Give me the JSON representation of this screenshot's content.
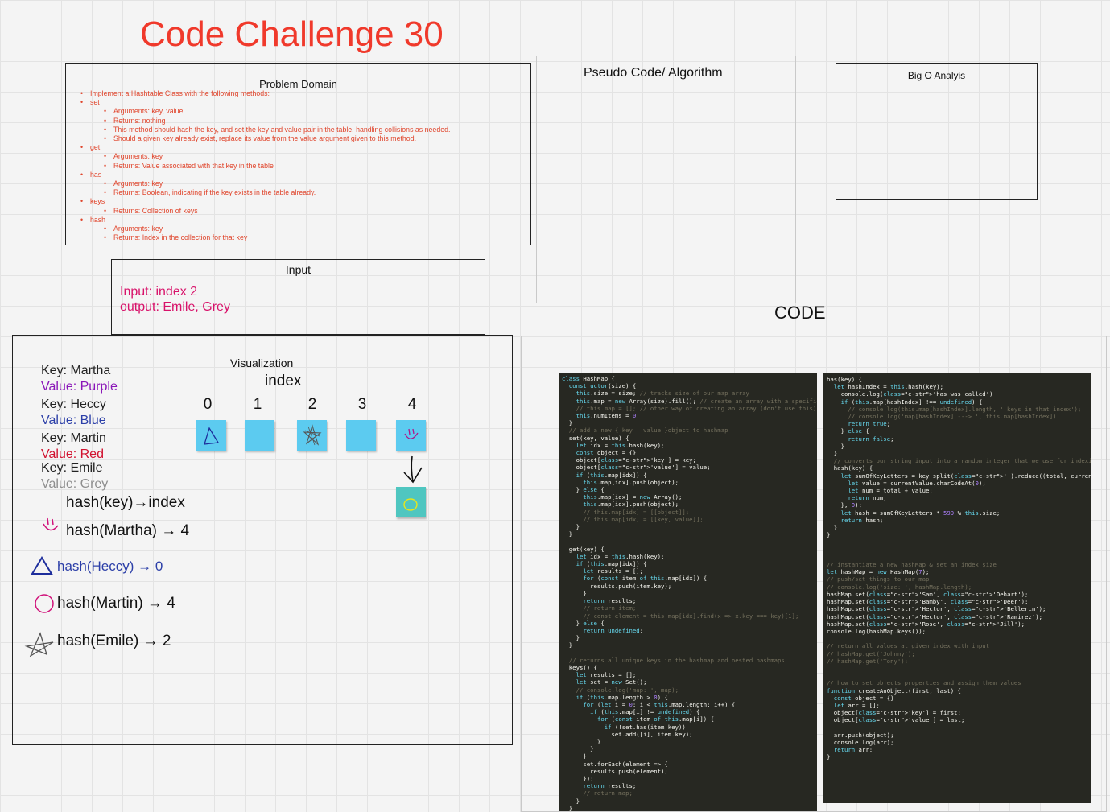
{
  "title": "Code Challenge 30",
  "problem_domain": {
    "title": "Problem Domain",
    "items": [
      {
        "level": 1,
        "text": "Implement a Hashtable Class with the following methods:"
      },
      {
        "level": 1,
        "text": "set"
      },
      {
        "level": 2,
        "text": "Arguments: key, value"
      },
      {
        "level": 2,
        "text": "Returns: nothing"
      },
      {
        "level": 2,
        "text": "This method should hash the key, and set the key and value pair in the table, handling collisions as needed."
      },
      {
        "level": 2,
        "text": "Should a given key already exist, replace its value from the value argument given to this method."
      },
      {
        "level": 1,
        "text": "get"
      },
      {
        "level": 2,
        "text": "Arguments: key"
      },
      {
        "level": 2,
        "text": "Returns: Value associated with that key in the table"
      },
      {
        "level": 1,
        "text": "has"
      },
      {
        "level": 2,
        "text": "Arguments: key"
      },
      {
        "level": 2,
        "text": "Returns: Boolean, indicating if the key exists in the table already."
      },
      {
        "level": 1,
        "text": "keys"
      },
      {
        "level": 2,
        "text": "Returns: Collection of keys"
      },
      {
        "level": 1,
        "text": "hash"
      },
      {
        "level": 2,
        "text": "Arguments: key"
      },
      {
        "level": 2,
        "text": "Returns: Index in the collection for that key"
      }
    ]
  },
  "pseudo_code": {
    "title": "Pseudo Code/ Algorithm"
  },
  "big_o": {
    "title": "Big O Analyis"
  },
  "input": {
    "title": "Input",
    "line1": "Input: index 2",
    "line2": "output: Emile, Grey"
  },
  "code_label": "CODE",
  "visualization": {
    "title": "Visualization",
    "index_label": "index",
    "indices": [
      "0",
      "1",
      "2",
      "3",
      "4"
    ],
    "pairs": [
      {
        "key": "Key: Martha",
        "value": "Value: Purple",
        "color": "#8a16b8"
      },
      {
        "key": "Key: Heccy",
        "value": "Value: Blue",
        "color": "#2c3fa8"
      },
      {
        "key": "Key: Martin",
        "value": "Value: Red",
        "color": "#d1122f"
      },
      {
        "key": "Key: Emile",
        "value": "Value: Grey",
        "color": "#8e8e8e"
      }
    ],
    "hash_formula": "hash(key)→index",
    "hash_rows": [
      {
        "text": "hash(Martha) → 4",
        "color": "#111111"
      },
      {
        "text": "hash(Heccy) → 0",
        "color": "#2c3fa8"
      },
      {
        "text": "hash(Martin) → 4",
        "color": "#111111"
      },
      {
        "text": "hash(Emile) → 2",
        "color": "#111111"
      }
    ]
  },
  "colors": {
    "title_red": "#f0392b",
    "list_red": "#e0452c",
    "input_pink": "#d8126a",
    "sticky_blue": "#5ccbf0",
    "sticky_teal": "#4fc6c0",
    "code_bg": "#272822"
  },
  "code_left": [
    "class HashMap {",
    "  constructor(size) {",
    "    this.size = size; // tracks size of our map array",
    "    this.map = new Array(size).fill(); // create an array with a specified size",
    "    // this.map = []; // other way of creating an array (don't use this)",
    "    this.numItems = 0;",
    "  }",
    "  // add a new { key : value }object to hashmap",
    "  set(key, value) {",
    "    let idx = this.hash(key);",
    "    const object = {}",
    "    object['key'] = key;",
    "    object['value'] = value;",
    "    if (this.map[idx]) {",
    "      this.map[idx].push(object);",
    "    } else {",
    "      this.map[idx] = new Array();",
    "      this.map[idx].push(object);",
    "      // this.map[idx] = [[object]];",
    "      // this.map[idx] = [[key, value]];",
    "    }",
    "  }",
    "",
    "  get(key) {",
    "    let idx = this.hash(key);",
    "    if (this.map[idx]) {",
    "      let results = [];",
    "      for (const item of this.map[idx]) {",
    "        results.push(item.key);",
    "      }",
    "      return results;",
    "      // return item;",
    "      // const element = this.map[idx].find(x => x.key === key)[1];",
    "    } else {",
    "      return undefined;",
    "    }",
    "  }",
    "",
    "  // returns all unique keys in the hashmap and nested hashmaps",
    "  keys() {",
    "    let results = [];",
    "    let set = new Set();",
    "    // console.log('map: ', map);",
    "    if (this.map.length > 0) {",
    "      for (let i = 0; i < this.map.length; i++) {",
    "        if (this.map[i] != undefined) {",
    "          for (const item of this.map[i]) {",
    "            if (!set.has(item.key))",
    "              set.add([i], item.key);",
    "          }",
    "        }",
    "      }",
    "      set.forEach(element => {",
    "        results.push(element);",
    "      });",
    "      return results;",
    "      // return map;",
    "    }",
    "  }"
  ],
  "code_right": [
    "has(key) {",
    "  let hashIndex = this.hash(key);",
    "    console.log('has was called')",
    "    if (this.map[hashIndex] !== undefined) {",
    "      // console.log(this.map[hashIndex].length, ' keys in that index');",
    "      // console.log('map[hashIndex] ---> ', this.map[hashIndex])",
    "      return true;",
    "    } else {",
    "      return false;",
    "    }",
    "  }",
    "  // converts our string input into a random integer that we use for indexing",
    "  hash(key) {",
    "    let sumOfKeyLetters = key.split('').reduce((total, currentValue) => {",
    "      let value = currentValue.charCodeAt(0);",
    "      let num = total + value;",
    "      return num;",
    "    }, 0);",
    "    let hash = sumOfKeyLetters * 599 % this.size;",
    "    return hash;",
    "  }",
    "}",
    "",
    "",
    "",
    "// instantiate a new hashMap & set an index size",
    "let hashMap = new HashMap(7);",
    "// push/set things to our map",
    "// console.log('size: ', hashMap.length);",
    "hashMap.set('Sam', 'Dehart');",
    "hashMap.set('Bamby', 'Deer');",
    "hashMap.set('Hector', 'Bellerin');",
    "hashMap.set('Hector', 'Ramirez');",
    "hashMap.set('Rose', 'Jill');",
    "console.log(hashMap.keys());",
    "",
    "// return all values at given index with input",
    "// hashMap.get('Johnny');",
    "// hashMap.get('Tony');",
    "",
    "",
    "// how to set objects properties and assign them values",
    "function createAnObject(first, last) {",
    "  const object = {}",
    "  let arr = [];",
    "  object['key'] = first;",
    "  object['value'] = last;",
    "",
    "  arr.push(object);",
    "  console.log(arr);",
    "  return arr;",
    "}"
  ]
}
